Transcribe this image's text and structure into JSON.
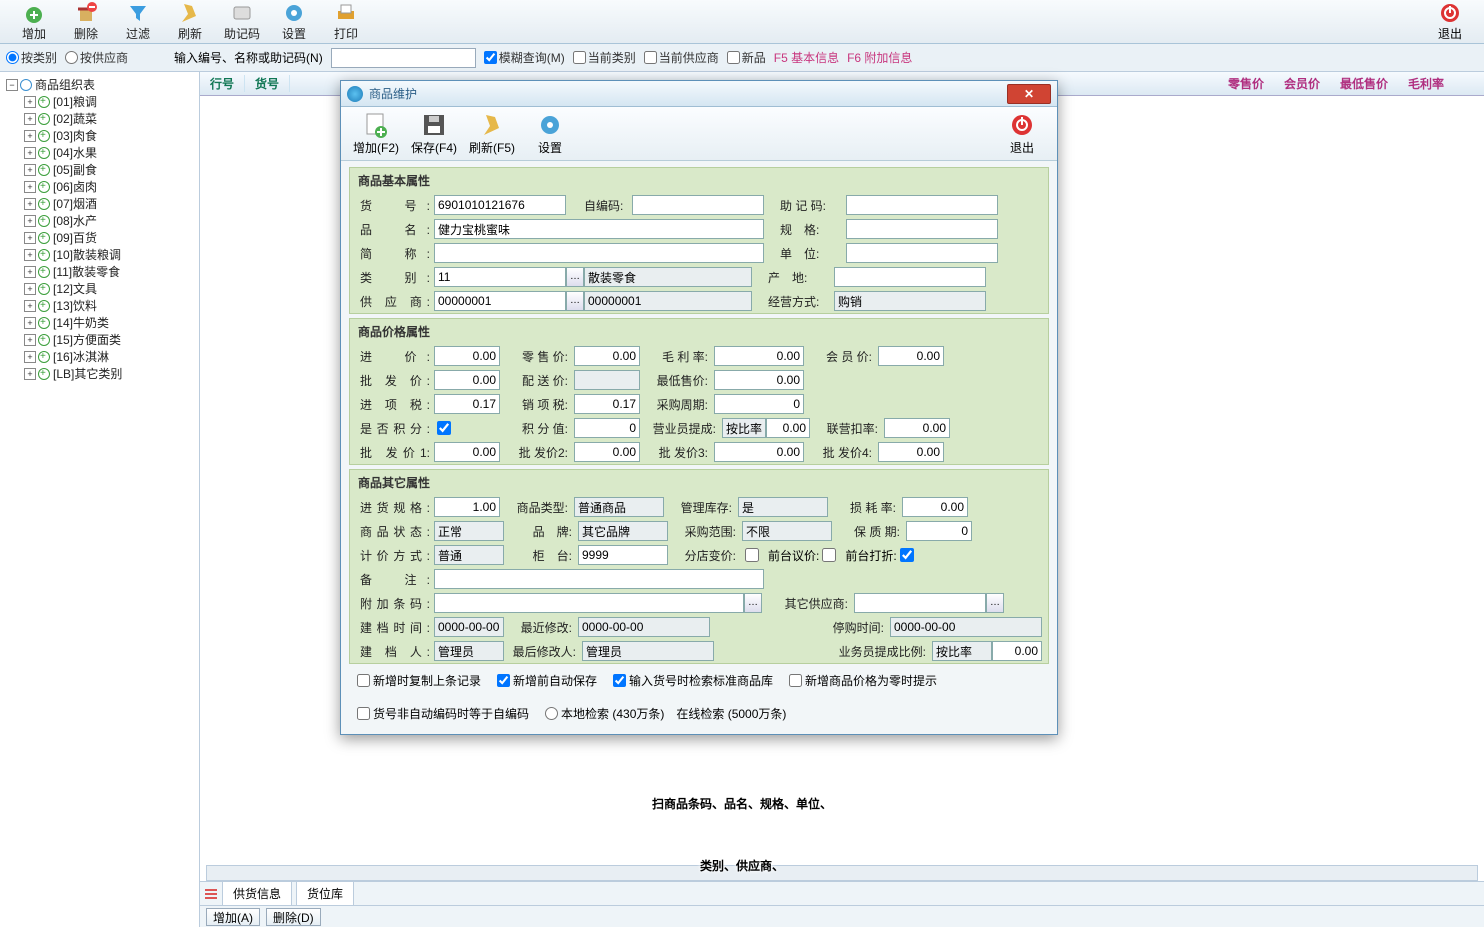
{
  "toolbar": {
    "add": "增加",
    "del": "删除",
    "filter": "过滤",
    "refresh": "刷新",
    "mnemonic": "助记码",
    "settings": "设置",
    "print": "打印",
    "exit": "退出"
  },
  "filter": {
    "by_category": "按类别",
    "by_supplier": "按供应商",
    "hint": "输入编号、名称或助记码(N)",
    "query": "",
    "fuzzy": "模糊查询(M)",
    "cur_cat": "当前类别",
    "cur_supplier": "当前供应商",
    "newflag": "新品",
    "f5": "F5 基本信息",
    "f6": "F6 附加信息"
  },
  "tree": {
    "root": "商品组织表",
    "items": [
      {
        "code": "[01]",
        "name": "粮调"
      },
      {
        "code": "[02]",
        "name": "蔬菜"
      },
      {
        "code": "[03]",
        "name": "肉食"
      },
      {
        "code": "[04]",
        "name": "水果"
      },
      {
        "code": "[05]",
        "name": "副食"
      },
      {
        "code": "[06]",
        "name": "卤肉"
      },
      {
        "code": "[07]",
        "name": "烟酒"
      },
      {
        "code": "[08]",
        "name": "水产"
      },
      {
        "code": "[09]",
        "name": "百货"
      },
      {
        "code": "[10]",
        "name": "散装粮调"
      },
      {
        "code": "[11]",
        "name": "散装零食"
      },
      {
        "code": "[12]",
        "name": "文具"
      },
      {
        "code": "[13]",
        "name": "饮料"
      },
      {
        "code": "[14]",
        "name": "牛奶类"
      },
      {
        "code": "[15]",
        "name": "方便面类"
      },
      {
        "code": "[16]",
        "name": "冰淇淋"
      },
      {
        "code": "[LB]",
        "name": "其它类别"
      }
    ]
  },
  "grid": {
    "row_no": "行号",
    "item_no": "货号",
    "retail": "零售价",
    "member": "会员价",
    "lowest": "最低售价",
    "margin": "毛利率"
  },
  "tabs": {
    "stock": "供货信息",
    "loc": "货位库"
  },
  "actions": {
    "add": "增加(A)",
    "del": "删除(D)"
  },
  "dialog": {
    "title": "商品维护",
    "tb": {
      "add": "增加(F2)",
      "save": "保存(F4)",
      "refresh": "刷新(F5)",
      "settings": "设置",
      "exit": "退出"
    },
    "sec_basic": "商品基本属性",
    "basic": {
      "code_l": "货　号:",
      "code_v": "6901010121676",
      "selfcode_l": "自编码:",
      "selfcode_v": "",
      "mnemonic_l": "助 记 码:",
      "mnemonic_v": "",
      "name_l": "品　名:",
      "name_v": "健力宝桃蜜味",
      "spec_l": "规　格:",
      "spec_v": "",
      "short_l": "简　称:",
      "short_v": "",
      "unit_l": "单　位:",
      "unit_v": "",
      "cat_l": "类　别:",
      "cat_v": "11",
      "cat_txt": "散装零食",
      "origin_l": "产　地:",
      "origin_v": "",
      "supplier_l": "供 应 商:",
      "supplier_v": "00000001",
      "supplier_txt": "00000001",
      "bizmode_l": "经营方式:",
      "bizmode_v": "购销"
    },
    "sec_price": "商品价格属性",
    "price": {
      "in_l": "进　价:",
      "in_v": "0.00",
      "retail_l": "零 售 价:",
      "retail_v": "0.00",
      "margin_l": "毛 利 率:",
      "margin_v": "0.00",
      "member_l": "会 员 价:",
      "member_v": "0.00",
      "whole_l": "批 发 价:",
      "whole_v": "0.00",
      "deliver_l": "配 送 价:",
      "deliver_v": "",
      "lowest_l": "最低售价:",
      "lowest_v": "0.00",
      "intax_l": "进 项 税:",
      "intax_v": "0.17",
      "outtax_l": "销 项 税:",
      "outtax_v": "0.17",
      "cycle_l": "采购周期:",
      "cycle_v": "0",
      "points_l": "是否积分:",
      "points_chk": true,
      "pointval_l": "积 分 值:",
      "pointval_v": "0",
      "clerk_l": "营业员提成:",
      "clerk_mode": "按比率",
      "clerk_v": "0.00",
      "union_l": "联营扣率:",
      "union_v": "0.00",
      "wp1_l": "批 发价1:",
      "wp1_v": "0.00",
      "wp2_l": "批 发价2:",
      "wp2_v": "0.00",
      "wp3_l": "批 发价3:",
      "wp3_v": "0.00",
      "wp4_l": "批 发价4:",
      "wp4_v": "0.00"
    },
    "sec_other": "商品其它属性",
    "other": {
      "inspec_l": "进货规格:",
      "inspec_v": "1.00",
      "ptype_l": "商品类型:",
      "ptype_v": "普通商品",
      "stockmgr_l": "管理库存:",
      "stockmgr_v": "是",
      "loss_l": "损 耗 率:",
      "loss_v": "0.00",
      "status_l": "商品状态:",
      "status_v": "正常",
      "brand_l": "品　牌:",
      "brand_v": "其它品牌",
      "scope_l": "采购范围:",
      "scope_v": "不限",
      "warranty_l": "保 质 期:",
      "warranty_v": "0",
      "pricemode_l": "计价方式:",
      "pricemode_v": "普通",
      "counter_l": "柜　台:",
      "counter_v": "9999",
      "branch_l": "分店变价:",
      "front_neg_l": "前台议价:",
      "front_disc_l": "前台打折:",
      "note_l": "备　注:",
      "note_v": "",
      "extrabar_l": "附加条码:",
      "extrabar_v": "",
      "othersup_l": "其它供应商:",
      "othersup_v": "",
      "created_l": "建档时间:",
      "created_v": "0000-00-00",
      "lastmod_l": "最近修改:",
      "lastmod_v": "0000-00-00",
      "stopbuy_l": "停购时间:",
      "stopbuy_v": "0000-00-00",
      "creator_l": "建 档 人:",
      "creator_v": "管理员",
      "modby_l": "最后修改人:",
      "modby_v": "管理员",
      "clerkratio_l": "业务员提成比例:",
      "clerkratio_mode": "按比率",
      "clerkratio_v": "0.00"
    },
    "opts": {
      "copy_last": "新增时复制上条记录",
      "autosave": "新增前自动保存",
      "search_std": "输入货号时检索标准商品库",
      "price_zero_tip": "新增商品价格为零时提示",
      "code_neq": "货号非自动编码时等于自编码",
      "local_search": "本地检索 (430万条)　在线检索 (5000万条)"
    }
  },
  "caption_l1": "扫商品条码、品名、规格、单位、",
  "caption_l2": "类别、供应商、"
}
